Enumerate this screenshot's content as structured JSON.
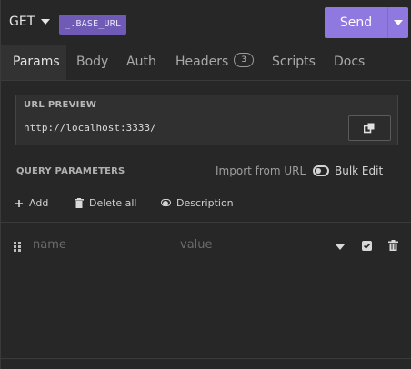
{
  "request": {
    "method": "GET",
    "url_env_tag": "_.BASE_URL",
    "send_label": "Send"
  },
  "tabs": [
    {
      "label": "Params",
      "active": true
    },
    {
      "label": "Body"
    },
    {
      "label": "Auth"
    },
    {
      "label": "Headers",
      "badge": "3"
    },
    {
      "label": "Scripts"
    },
    {
      "label": "Docs"
    }
  ],
  "url_preview": {
    "title": "URL PREVIEW",
    "value": "http://localhost:3333/"
  },
  "query_params": {
    "title": "QUERY PARAMETERS",
    "import_label": "Import from URL",
    "bulk_edit_label": "Bulk Edit",
    "actions": {
      "add": "Add",
      "delete_all": "Delete all",
      "description": "Description"
    },
    "row": {
      "name_placeholder": "name",
      "value_placeholder": "value",
      "enabled": true
    }
  },
  "colors": {
    "accent": "#8f79e0",
    "env_tag": "#6f5bb5",
    "background": "#272727"
  }
}
